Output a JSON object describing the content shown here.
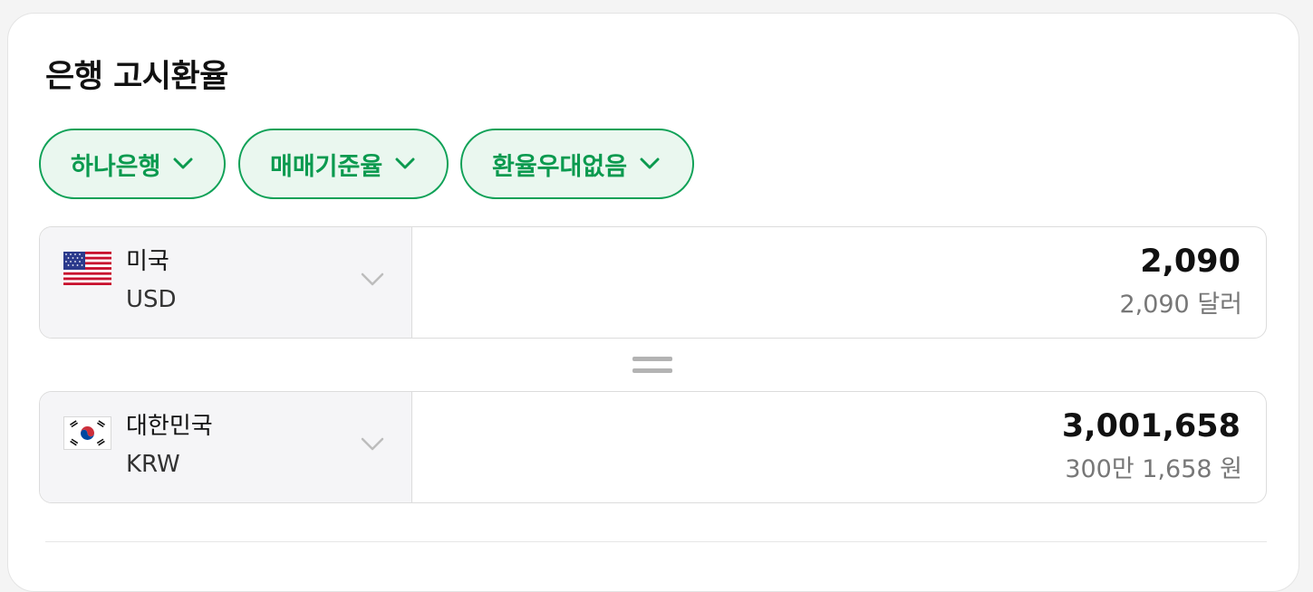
{
  "title": "은행 고시환율",
  "filters": [
    {
      "label": "하나은행"
    },
    {
      "label": "매매기준율"
    },
    {
      "label": "환율우대없음"
    }
  ],
  "from_currency": {
    "country": "미국",
    "code": "USD",
    "flag_icon": "us-flag-icon",
    "amount": "2,090",
    "amount_text": "2,090 달러"
  },
  "to_currency": {
    "country": "대한민국",
    "code": "KRW",
    "flag_icon": "kr-flag-icon",
    "amount": "3,001,658",
    "amount_text": "300만 1,658 원"
  },
  "colors": {
    "accent_green": "#0fa157",
    "chip_bg": "#eaf7ef",
    "secondary_text": "#777777"
  }
}
